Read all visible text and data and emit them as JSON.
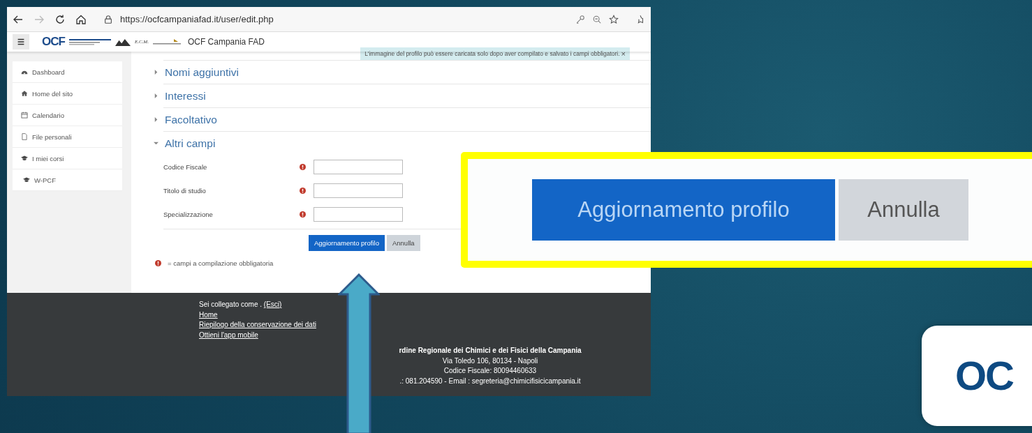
{
  "browser": {
    "url": "https://ocfcampaniafad.it/user/edit.php",
    "forward_disabled": true
  },
  "header": {
    "logo_text": "OCF",
    "ecm_text": "E.C.M.",
    "site_name": "OCF Campania FAD"
  },
  "sidebar": {
    "items": [
      {
        "label": "Dashboard",
        "kind": "dashboard"
      },
      {
        "label": "Home del sito",
        "kind": "home"
      },
      {
        "label": "Calendario",
        "kind": "calendar"
      },
      {
        "label": "File personali",
        "kind": "files"
      },
      {
        "label": "I miei corsi",
        "kind": "courses"
      },
      {
        "label": "W-PCF",
        "kind": "course"
      }
    ]
  },
  "notice": {
    "text": "L'immagine del profilo può essere caricata solo dopo aver compilato e salvato i campi obbligatori.",
    "close": "×"
  },
  "sections": [
    {
      "title": "Nomi aggiuntivi",
      "expanded": false
    },
    {
      "title": "Interessi",
      "expanded": false
    },
    {
      "title": "Facoltativo",
      "expanded": false
    },
    {
      "title": "Altri campi",
      "expanded": true,
      "fields": [
        {
          "label": "Codice Fiscale",
          "required": true
        },
        {
          "label": "Titolo di studio",
          "required": true
        },
        {
          "label": "Specializzazione",
          "required": true
        }
      ]
    }
  ],
  "buttons": [
    {
      "label": "Aggiornamento profilo",
      "kind": "primary"
    },
    {
      "label": "Annulla",
      "kind": "secondary"
    }
  ],
  "legend": "= campi a compilazione obbligatoria",
  "footer": {
    "login_text": "Sei collegato come .",
    "logout_link": "(Esci)",
    "links": [
      "Home",
      "Riepilogo della conservazione dei dati",
      "Ottieni l'app mobile"
    ],
    "org_lines": [
      {
        "text": "rdine Regionale dei Chimici e dei Fisici della Campania",
        "bold": true
      },
      {
        "text": "Via Toledo 106, 80134 - Napoli",
        "bold": false
      },
      {
        "text": "Codice Fiscale: 80094460633",
        "bold": false
      },
      {
        "text": ".: 081.204590 - Email : segreteria@chimicifisicicampania.it",
        "bold": false
      }
    ]
  },
  "callout": {
    "buttons": [
      {
        "label": "Aggiornamento profilo",
        "kind": "primary"
      },
      {
        "label": "Annulla",
        "kind": "secondary"
      }
    ]
  },
  "logo": {
    "text": "OC"
  }
}
